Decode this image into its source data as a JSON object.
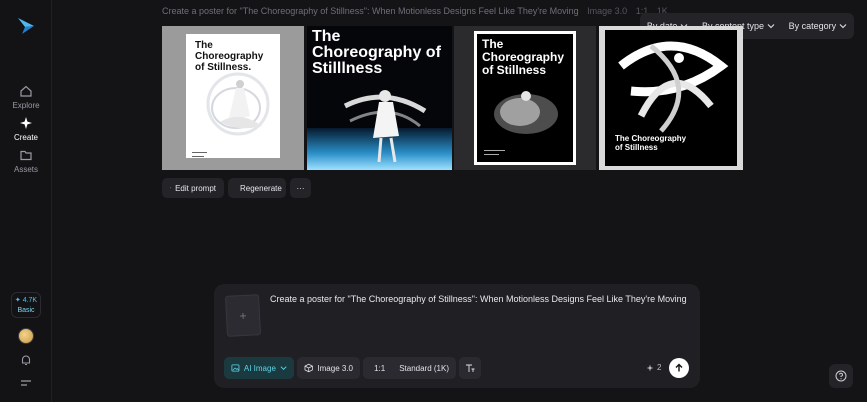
{
  "sidebar": {
    "items": [
      {
        "label": "Explore",
        "icon": "home-icon"
      },
      {
        "label": "Create",
        "icon": "sparkle-icon"
      },
      {
        "label": "Assets",
        "icon": "folder-icon"
      }
    ],
    "credits": "4.7K",
    "plan": "Basic"
  },
  "prompt_line": {
    "text": "Create a poster for \"The Choreography of Stillness\": When Motionless Designs Feel Like They're Moving",
    "model": "Image 3.0",
    "ratio": "1:1",
    "quality": "1K"
  },
  "filters": [
    "By date",
    "By content type",
    "By category"
  ],
  "posters": [
    {
      "title": "The Choreography of Stillness."
    },
    {
      "title": "The Choreography of Stilllness"
    },
    {
      "title": "The Choreography of Stillness"
    },
    {
      "title": "The Choreography of Stillness"
    }
  ],
  "actions": {
    "edit": "Edit prompt",
    "regenerate": "Regenerate",
    "more": "···"
  },
  "composer": {
    "text": "Create a poster for \"The Choreography of Stillness\": When Motionless Designs Feel Like They're Moving",
    "add": "+",
    "mode": "AI Image",
    "model": "Image 3.0",
    "ratio": "1:1",
    "quality": "Standard (1K)",
    "count": "2"
  },
  "colors": {
    "background": "#141417",
    "panel": "#1f1f24",
    "accent": "#5fd2e6"
  }
}
